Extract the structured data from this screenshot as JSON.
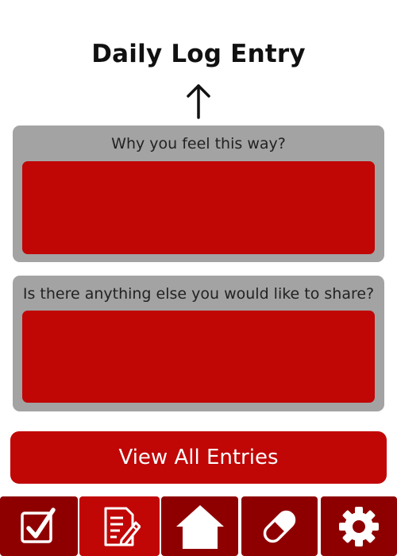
{
  "header": {
    "title": "Daily Log Entry",
    "arrow_icon": "up-arrow-icon"
  },
  "cards": [
    {
      "label": "Why you feel this way?",
      "value": ""
    },
    {
      "label": "Is there anything else you would like to share?",
      "value": ""
    }
  ],
  "actions": {
    "view_all_label": "View All Entries"
  },
  "bottom_nav": {
    "items": [
      {
        "icon": "checkbox-icon",
        "active": false
      },
      {
        "icon": "edit-document-icon",
        "active": true
      },
      {
        "icon": "home-icon",
        "active": false
      },
      {
        "icon": "pill-icon",
        "active": false
      },
      {
        "icon": "gear-icon",
        "active": false
      }
    ]
  },
  "colors": {
    "primary_red": "#c10606",
    "dark_red": "#8e0000",
    "card_gray": "#a3a3a3",
    "title_text": "#111111"
  }
}
